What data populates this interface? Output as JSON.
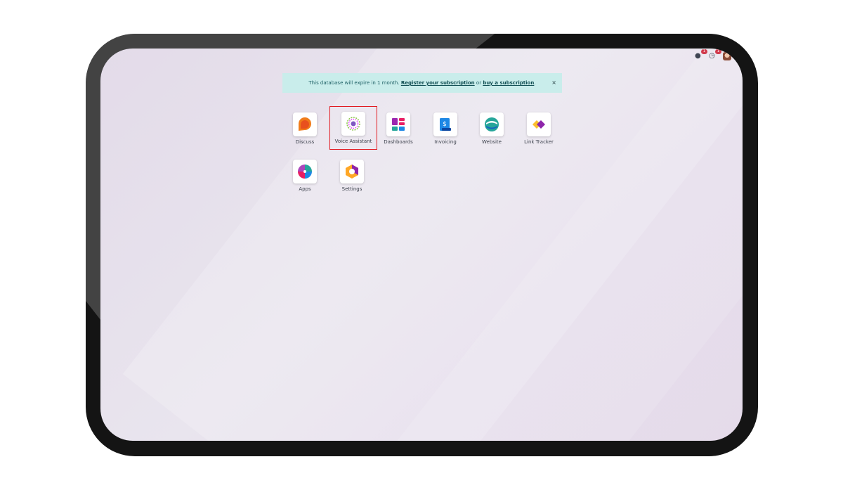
{
  "banner": {
    "prefix": "This database will expire in 1 month.",
    "register_link": "Register your subscription",
    "middle": "or",
    "buy_link": "buy a subscription",
    "suffix": ".",
    "close_label": "×"
  },
  "topbar": {
    "messages_count": "1",
    "activity_count": "1"
  },
  "apps": [
    {
      "label": "Discuss",
      "icon": "discuss-icon",
      "selected": false
    },
    {
      "label": "Voice Assistant",
      "icon": "voice-assistant-icon",
      "selected": true
    },
    {
      "label": "Dashboards",
      "icon": "dashboards-icon",
      "selected": false
    },
    {
      "label": "Invoicing",
      "icon": "invoicing-icon",
      "selected": false
    },
    {
      "label": "Website",
      "icon": "website-icon",
      "selected": false
    },
    {
      "label": "Link Tracker",
      "icon": "link-tracker-icon",
      "selected": false
    },
    {
      "label": "Apps",
      "icon": "apps-icon",
      "selected": false
    },
    {
      "label": "Settings",
      "icon": "settings-icon",
      "selected": false
    }
  ],
  "colors": {
    "highlight": "#e11b22",
    "banner_bg": "#c9edeb"
  }
}
